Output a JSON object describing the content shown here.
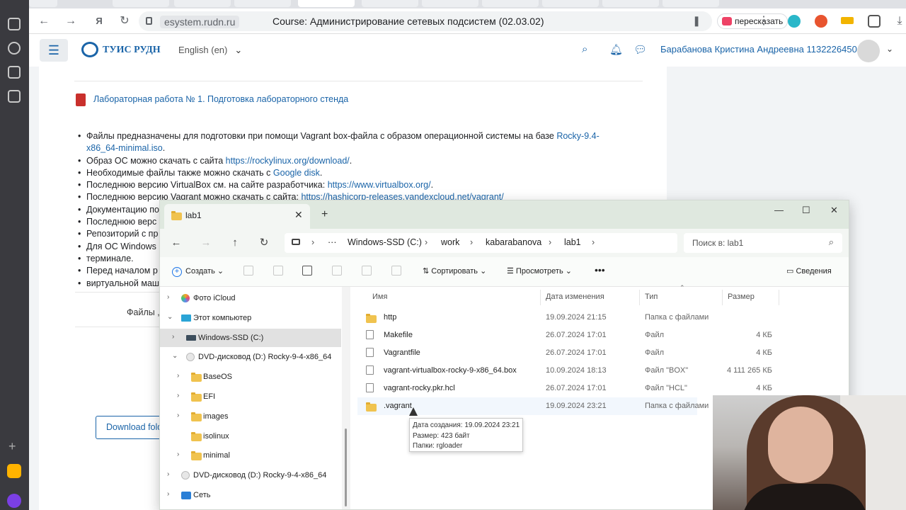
{
  "browser": {
    "domain": "esystem.rudn.ru",
    "page_title": "Course: Администрирование сетевых подсистем (02.03.02)",
    "retell_label": "пересказать"
  },
  "lms": {
    "brand": "ТУИС РУДН",
    "language": "English (en)",
    "user_name": "Барабанова Кристина Андреевна 1132226450"
  },
  "course": {
    "lab_title": "Лабораторная работа № 1. Подготовка лабораторного стенда",
    "bullets": [
      {
        "text": "Файлы предназначены для подготовки при помощи Vagrant box-файла с образом операционной системы на базе ",
        "link": "Rocky-9.4-x86_64-minimal.iso",
        "after": "."
      },
      {
        "text": "Образ ОС можно скачать с сайта ",
        "link": "https://rockylinux.org/download/",
        "after": "."
      },
      {
        "text": "Необходимые файлы также можно скачать с ",
        "link": "Google disk",
        "after": "."
      },
      {
        "text": "Последнюю версию VirtualBox см. на сайте разработчика: ",
        "link": "https://www.virtualbox.org/",
        "after": "."
      },
      {
        "text": "Последнюю версию Vagrant можно скачать с сайта: ",
        "link": "https://hashicorp-releases.yandexcloud.net/vagrant/",
        "after": ""
      },
      {
        "text": "Документацию по",
        "link": "",
        "after": ""
      },
      {
        "text": "Последнюю верс",
        "link": "",
        "after": ""
      },
      {
        "text": "Репозиторий с пр",
        "link": "",
        "after": ""
      },
      {
        "text": "Для ОС Windows",
        "link": "",
        "after": ""
      },
      {
        "text": "терминале.",
        "link": "",
        "after": ""
      },
      {
        "text": "Перед началом р",
        "link": "",
        "after": ""
      },
      {
        "text": "виртуальной маш",
        "link": "",
        "after": ""
      }
    ],
    "files_label": "Файлы ,",
    "download_label": "Download folder"
  },
  "explorer": {
    "tab_title": "lab1",
    "breadcrumb": [
      "Windows-SSD (C:)",
      "work",
      "kabarabanova",
      "lab1"
    ],
    "search_placeholder": "Поиск в: lab1",
    "toolbar": {
      "create": "Создать",
      "sort": "Сортировать",
      "view": "Просмотреть",
      "details": "Сведения"
    },
    "tree": [
      {
        "label": "Фото iCloud",
        "icon": "icloud-photos-icon",
        "chev": "›",
        "indent": 0,
        "selected": false
      },
      {
        "label": "Этот компьютер",
        "icon": "computer-icon",
        "chev": "⌄",
        "indent": 0,
        "selected": false
      },
      {
        "label": "Windows-SSD (C:)",
        "icon": "drive-icon",
        "chev": "›",
        "indent": 1,
        "selected": true
      },
      {
        "label": "DVD-дисковод (D:) Rocky-9-4-x86_64",
        "icon": "dvd-icon",
        "chev": "⌄",
        "indent": 1,
        "selected": false
      },
      {
        "label": "BaseOS",
        "icon": "folder-icon",
        "chev": "›",
        "indent": 2,
        "selected": false
      },
      {
        "label": "EFI",
        "icon": "folder-icon",
        "chev": "›",
        "indent": 2,
        "selected": false
      },
      {
        "label": "images",
        "icon": "folder-icon",
        "chev": "›",
        "indent": 2,
        "selected": false
      },
      {
        "label": "isolinux",
        "icon": "folder-icon",
        "chev": "",
        "indent": 2,
        "selected": false
      },
      {
        "label": "minimal",
        "icon": "folder-icon",
        "chev": "›",
        "indent": 2,
        "selected": false
      },
      {
        "label": "DVD-дисковод (D:) Rocky-9-4-x86_64",
        "icon": "dvd-icon",
        "chev": "›",
        "indent": 0,
        "selected": false
      },
      {
        "label": "Сеть",
        "icon": "network-icon",
        "chev": "›",
        "indent": 0,
        "selected": false
      }
    ],
    "columns": [
      "Имя",
      "Дата изменения",
      "Тип",
      "Размер"
    ],
    "files": [
      {
        "name": "http",
        "date": "19.09.2024 21:15",
        "type": "Папка с файлами",
        "size": "",
        "icon": "folder-icon"
      },
      {
        "name": "Makefile",
        "date": "26.07.2024 17:01",
        "type": "Файл",
        "size": "4 КБ",
        "icon": "file-icon"
      },
      {
        "name": "Vagrantfile",
        "date": "26.07.2024 17:01",
        "type": "Файл",
        "size": "4 КБ",
        "icon": "file-icon"
      },
      {
        "name": "vagrant-virtualbox-rocky-9-x86_64.box",
        "date": "10.09.2024 18:13",
        "type": "Файл \"BOX\"",
        "size": "4 111 265 КБ",
        "icon": "file-icon"
      },
      {
        "name": "vagrant-rocky.pkr.hcl",
        "date": "26.07.2024 17:01",
        "type": "Файл \"HCL\"",
        "size": "4 КБ",
        "icon": "file-icon"
      },
      {
        "name": ".vagrant",
        "date": "19.09.2024 23:21",
        "type": "Папка с файлами",
        "size": "",
        "icon": "folder-icon"
      }
    ],
    "tooltip": [
      "Дата создания: 19.09.2024 23:21",
      "Размер: 423 байт",
      "Папки: rgloader"
    ]
  },
  "colors": {
    "link": "#1a64a8",
    "folder": "#f0c34f",
    "selected_row": "#e1e1e1"
  }
}
